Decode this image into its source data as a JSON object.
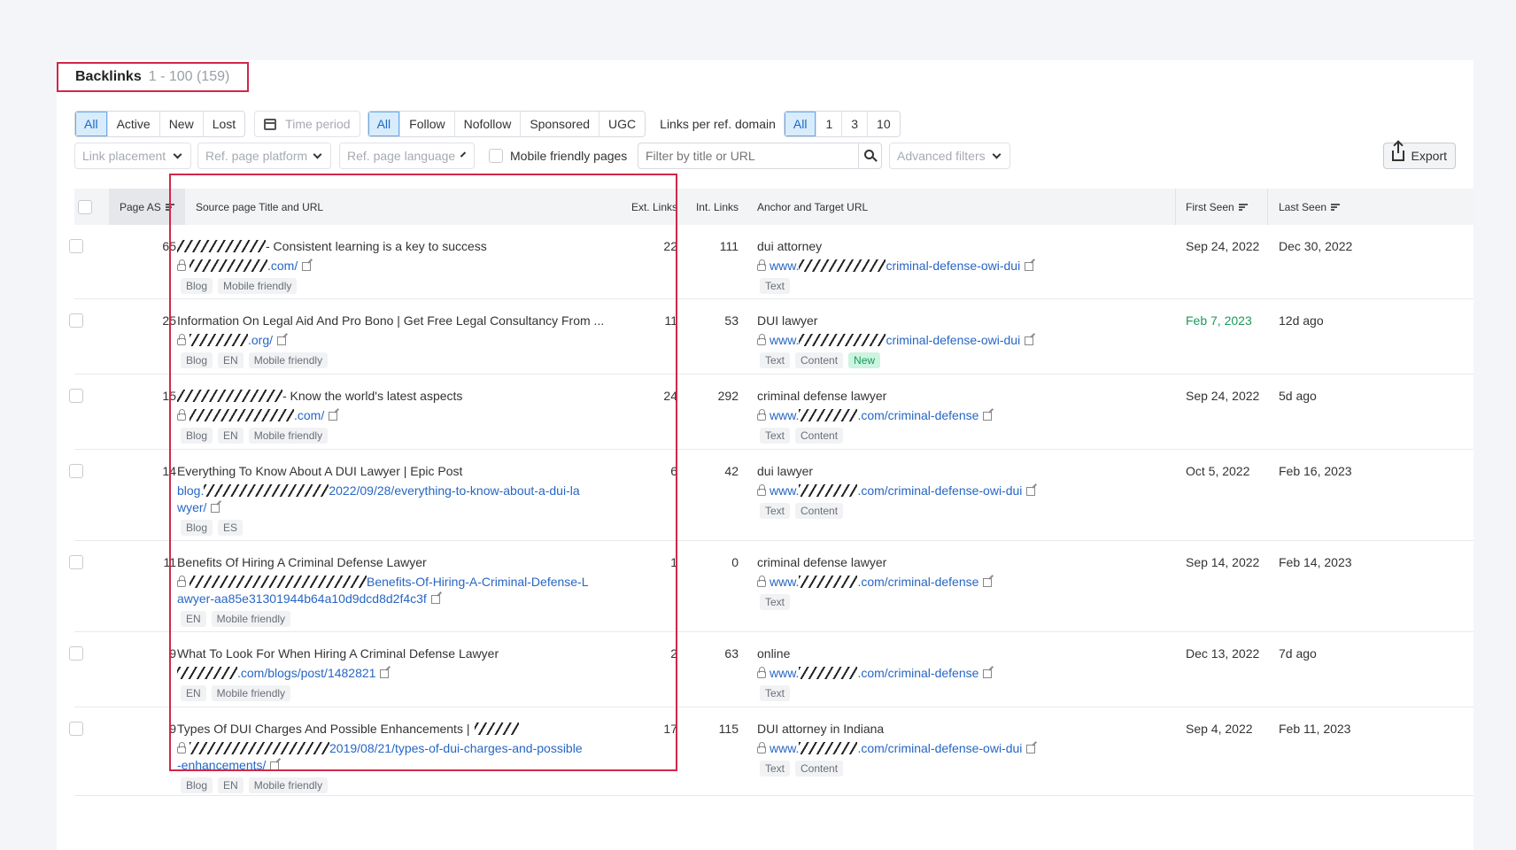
{
  "header": {
    "title": "Backlinks",
    "count": "1 - 100 (159)"
  },
  "filters": {
    "status": [
      "All",
      "Active",
      "New",
      "Lost"
    ],
    "time_period": "Time period",
    "link_types": [
      "All",
      "Follow",
      "Nofollow",
      "Sponsored",
      "UGC"
    ],
    "links_per_domain_label": "Links per ref. domain",
    "links_per_domain": [
      "All",
      "1",
      "3",
      "10"
    ],
    "link_placement": "Link placement",
    "ref_platform": "Ref. page platform",
    "ref_language": "Ref. page language",
    "mobile_friendly": "Mobile friendly pages",
    "search_placeholder": "Filter by title or URL",
    "advanced": "Advanced filters",
    "export": "Export"
  },
  "columns": {
    "page_as": "Page AS",
    "source": "Source page Title and URL",
    "ext": "Ext. Links",
    "int": "Int. Links",
    "anchor": "Anchor and Target URL",
    "first": "First Seen",
    "last": "Last Seen"
  },
  "rows": [
    {
      "as": "65",
      "title": "- Consistent learning is a key to success",
      "url1": ".com/",
      "url2": "",
      "tags": [
        "Blog",
        "Mobile friendly"
      ],
      "ext": "22",
      "int": "111",
      "anchor": "dui attorney",
      "target_pre": "www.",
      "target": "criminal-defense-owi-dui",
      "atags": [
        "Text"
      ],
      "first": "Sep 24, 2022",
      "last": "Dec 30, 2022"
    },
    {
      "as": "25",
      "title": "Information On Legal Aid And Pro Bono | Get Free Legal Consultancy From ...",
      "url1": ".org/",
      "url2": "",
      "tags": [
        "Blog",
        "EN",
        "Mobile friendly"
      ],
      "ext": "11",
      "int": "53",
      "anchor": "DUI lawyer",
      "target_pre": "www.",
      "target": "criminal-defense-owi-dui",
      "atags": [
        "Text",
        "Content",
        "New"
      ],
      "first": "Feb 7, 2023",
      "last": "12d ago"
    },
    {
      "as": "15",
      "title": "- Know the world's latest aspects",
      "url1": ".com/",
      "url2": "",
      "tags": [
        "Blog",
        "EN",
        "Mobile friendly"
      ],
      "ext": "24",
      "int": "292",
      "anchor": "criminal defense lawyer",
      "target_pre": "www.",
      "target": ".com/criminal-defense",
      "atags": [
        "Text",
        "Content"
      ],
      "first": "Sep 24, 2022",
      "last": "5d ago"
    },
    {
      "as": "14",
      "title": "Everything To Know About A DUI Lawyer | Epic Post",
      "url1": "2022/09/28/everything-to-know-about-a-dui-la",
      "url2": "wyer/",
      "url_pre": "blog.",
      "tags": [
        "Blog",
        "ES"
      ],
      "ext": "6",
      "int": "42",
      "anchor": "dui lawyer",
      "target_pre": "www.",
      "target": ".com/criminal-defense-owi-dui",
      "atags": [
        "Text",
        "Content"
      ],
      "first": "Oct 5, 2022",
      "last": "Feb 16, 2023"
    },
    {
      "as": "11",
      "title": "Benefits Of Hiring A Criminal Defense Lawyer",
      "url1": "Benefits-Of-Hiring-A-Criminal-Defense-L",
      "url2": "awyer-aa85e31301944b64a10d9dcd8d2f4c3f",
      "tags": [
        "EN",
        "Mobile friendly"
      ],
      "ext": "1",
      "int": "0",
      "anchor": "criminal defense lawyer",
      "target_pre": "www.",
      "target": ".com/criminal-defense",
      "atags": [
        "Text"
      ],
      "first": "Sep 14, 2022",
      "last": "Feb 14, 2023"
    },
    {
      "as": "9",
      "title": "What To Look For When Hiring A Criminal Defense Lawyer",
      "url1": ".com/blogs/post/1482821",
      "url2": "",
      "tags": [
        "EN",
        "Mobile friendly"
      ],
      "ext": "2",
      "int": "63",
      "anchor": "online",
      "target_pre": "www.",
      "target": ".com/criminal-defense",
      "atags": [
        "Text"
      ],
      "first": "Dec 13, 2022",
      "last": "7d ago"
    },
    {
      "as": "9",
      "title": "Types Of DUI Charges And Possible Enhancements |",
      "url1": "2019/08/21/types-of-dui-charges-and-possible",
      "url2": "-enhancements/",
      "tags": [
        "Blog",
        "EN",
        "Mobile friendly"
      ],
      "ext": "17",
      "int": "115",
      "anchor": "DUI attorney in Indiana",
      "target_pre": "www.",
      "target": ".com/criminal-defense-owi-dui",
      "atags": [
        "Text",
        "Content"
      ],
      "first": "Sep 4, 2022",
      "last": "Feb 11, 2023"
    }
  ]
}
